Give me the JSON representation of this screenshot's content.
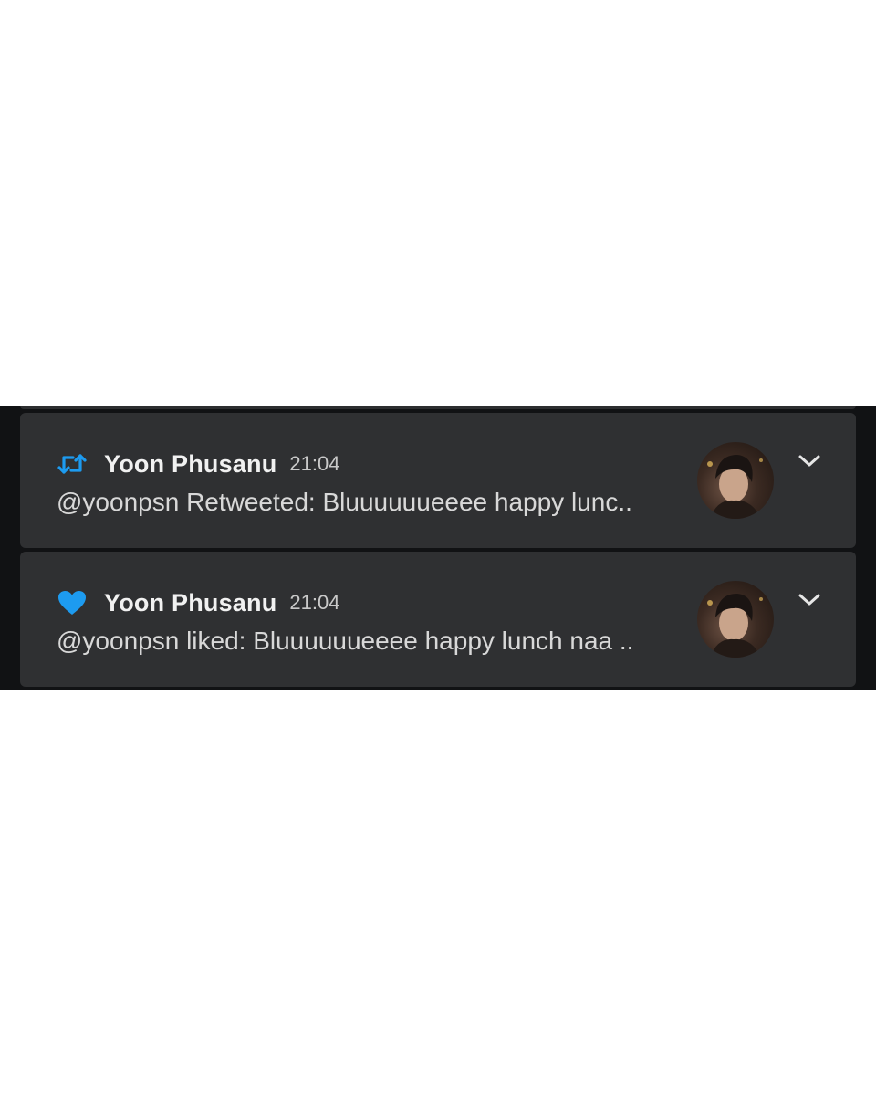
{
  "notifications": [
    {
      "type": "retweet",
      "icon": "retweet-icon",
      "sender": "Yoon Phusanu",
      "time": "21:04",
      "message": "@yoonpsn Retweeted: Bluuuuuueeee happy lunc..",
      "icon_color": "#1d9bf0"
    },
    {
      "type": "like",
      "icon": "heart-icon",
      "sender": "Yoon Phusanu",
      "time": "21:04",
      "message": "@yoonpsn liked: Bluuuuuueeee happy lunch naa ..",
      "icon_color": "#1d9bf0"
    }
  ],
  "colors": {
    "card_background": "#2f3032",
    "strip_background": "#111214",
    "page_background": "#ffffff"
  }
}
